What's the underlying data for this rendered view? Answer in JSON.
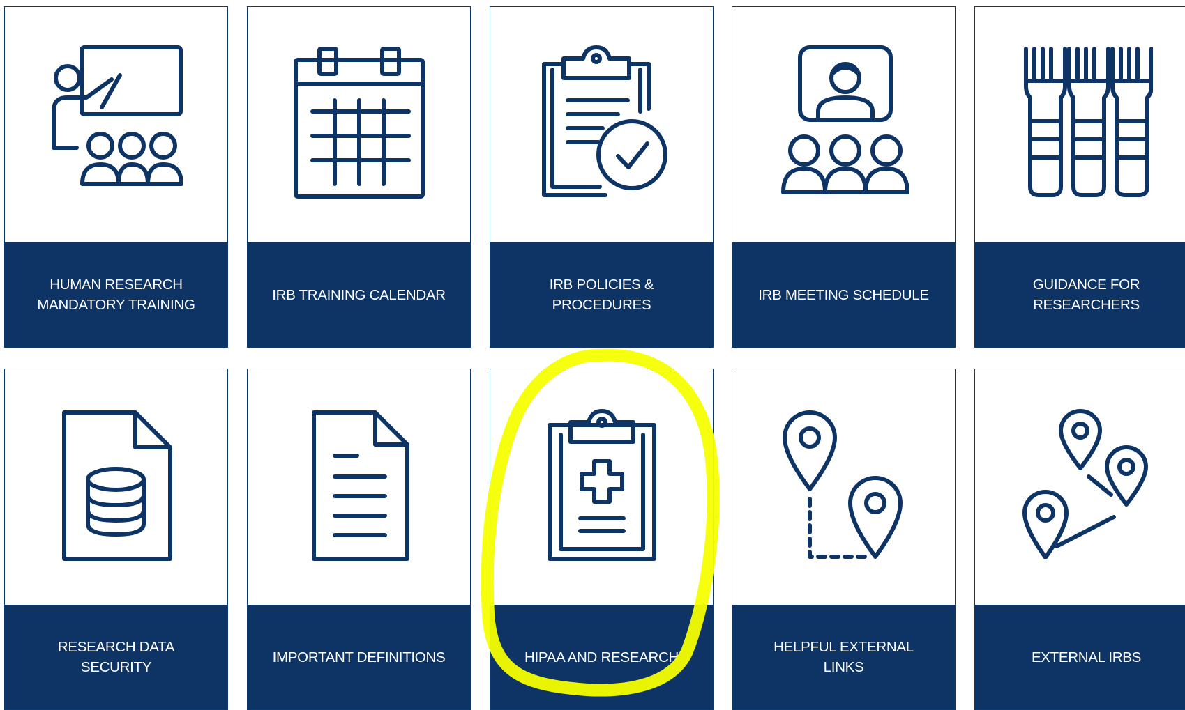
{
  "tiles": [
    {
      "label": "HUMAN RESEARCH MANDATORY TRAINING",
      "icon": "presentation-training-icon"
    },
    {
      "label": "IRB TRAINING CALENDAR",
      "icon": "calendar-icon"
    },
    {
      "label": "IRB POLICIES & PROCEDURES",
      "icon": "clipboard-check-icon"
    },
    {
      "label": "IRB MEETING SCHEDULE",
      "icon": "video-meeting-icon"
    },
    {
      "label": "GUIDANCE FOR RESEARCHERS",
      "icon": "books-icon"
    },
    {
      "label": "RESEARCH DATA SECURITY",
      "icon": "database-document-icon"
    },
    {
      "label": "IMPORTANT DEFINITIONS",
      "icon": "document-icon"
    },
    {
      "label": "HIPAA AND RESEARCH",
      "icon": "medical-clipboard-icon"
    },
    {
      "label": "HELPFUL EXTERNAL LINKS",
      "icon": "route-pins-icon"
    },
    {
      "label": "EXTERNAL IRBS",
      "icon": "connected-pins-icon"
    }
  ],
  "colors": {
    "navy": "#0e3466",
    "highlight": "#f5ff00"
  }
}
